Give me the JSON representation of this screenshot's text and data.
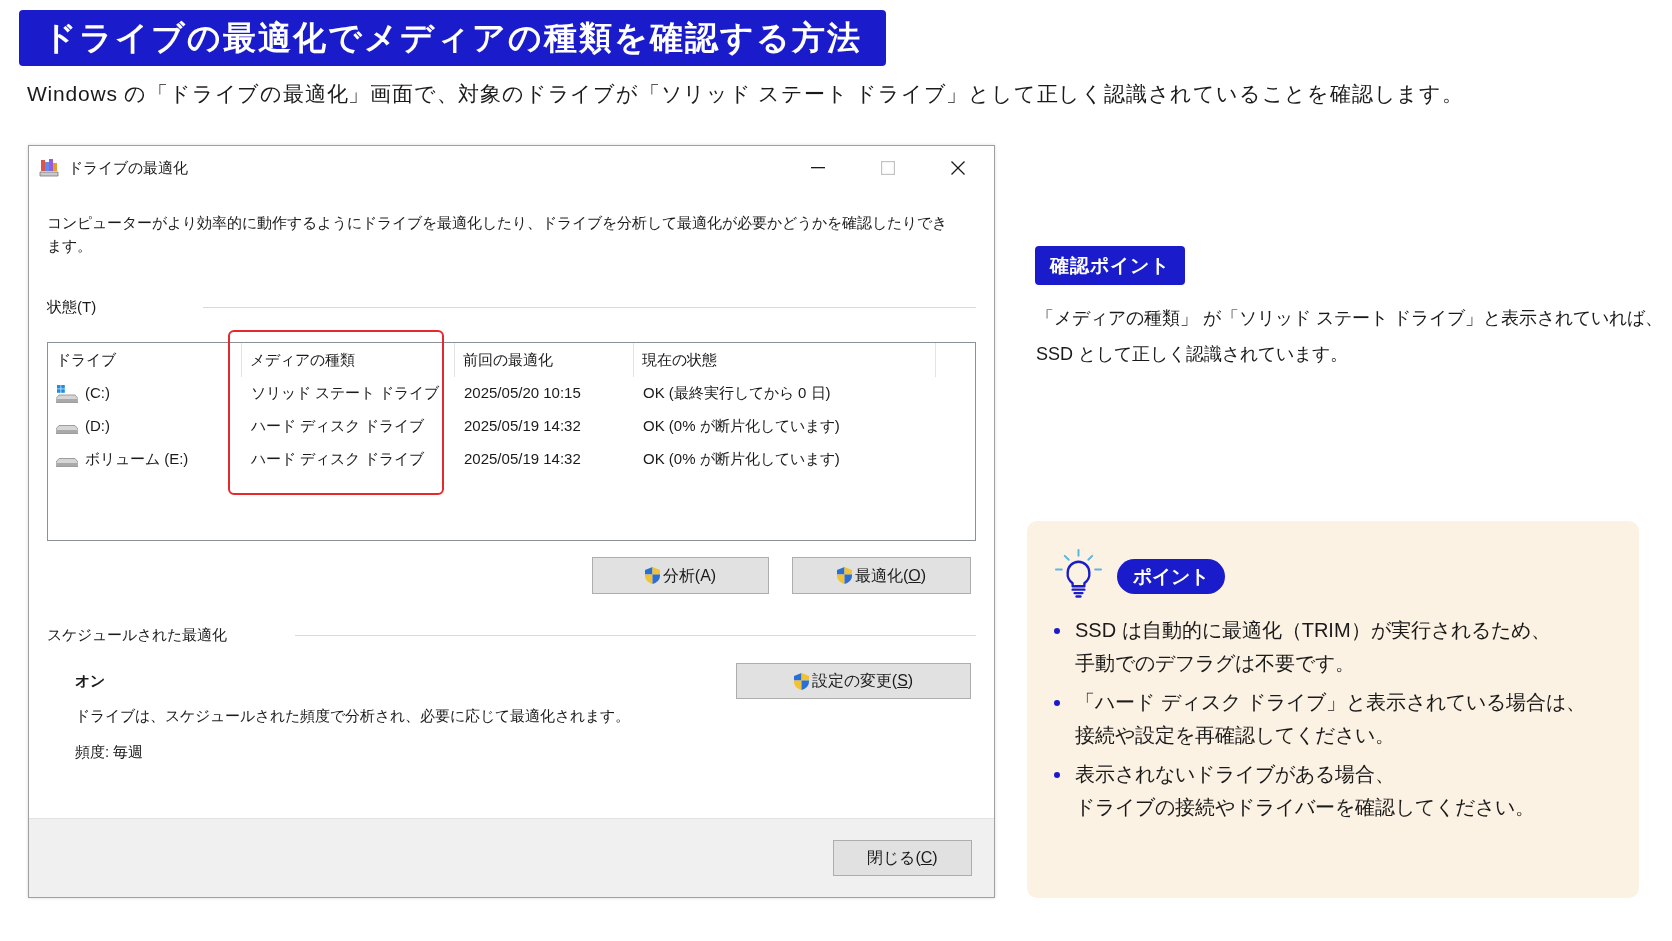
{
  "heading": "ドライブの最適化でメディアの種類を確認する方法",
  "subtitle": "Windows の「ドライブの最適化」画面で、対象のドライブが「ソリッド ステート ドライブ」として正しく認識されていることを確認します。",
  "dialog": {
    "title": "ドライブの最適化",
    "window_buttons": [
      {
        "kind": "minimize",
        "disabled": false
      },
      {
        "kind": "maximize",
        "disabled": true
      },
      {
        "kind": "close",
        "disabled": false
      }
    ],
    "description": "コンピューターがより効率的に動作するようにドライブを最適化したり、ドライブを分析して最適化が必要かどうかを確認したりできます。",
    "status_label": "状態(T)",
    "table": {
      "columns": [
        {
          "label": "ドライブ",
          "highlighted": false
        },
        {
          "label": "メディアの種類",
          "highlighted": true
        },
        {
          "label": "前回の最適化",
          "highlighted": false
        },
        {
          "label": "現在の状態",
          "highlighted": false
        }
      ],
      "rows": [
        {
          "kind": "system",
          "drive": "(C:)",
          "media_type": "ソリッド ステート ドライブ",
          "last_optimized": "2025/05/20 10:15",
          "current_status": "OK (最終実行してから 0 日)"
        },
        {
          "kind": "disk",
          "drive": "(D:)",
          "media_type": "ハード ディスク ドライブ",
          "last_optimized": "2025/05/19 14:32",
          "current_status": "OK (0% が断片化しています)"
        },
        {
          "kind": "disk",
          "drive": "ボリューム (E:)",
          "media_type": "ハード ディスク ドライブ",
          "last_optimized": "2025/05/19 14:32",
          "current_status": "OK (0% が断片化しています)"
        }
      ]
    },
    "actions": [
      {
        "label": "分析(",
        "access_key": "A",
        "label_end": ")",
        "underlined": false,
        "shield": true
      },
      {
        "label": "最適化(",
        "access_key": "O",
        "label_end": ")",
        "underlined": true,
        "shield": true
      }
    ],
    "schedule": {
      "label": "スケジュールされた最適化",
      "state": "オン",
      "description": "ドライブは、スケジュールされた頻度で分析され、必要に応じて最適化されます。",
      "frequency": "頻度: 毎週",
      "button": {
        "label": "設定の変更(",
        "access_key": "S",
        "label_end": ")",
        "underlined": true,
        "shield": true
      }
    },
    "close_button": {
      "label": "閉じる(",
      "access_key": "C",
      "label_end": ")",
      "underlined": true,
      "shield": false
    }
  },
  "check_point": {
    "badge": "確認ポイント",
    "text": "「メディアの種類」 が「ソリッド ステート ドライブ」と表示されていれば、SSD として正しく認識されています。"
  },
  "tips": {
    "badge": "ポイント",
    "items": [
      "SSD は自動的に最適化（TRIM）が実行されるため、手動でのデフラグは不要です。",
      "「ハード ディスク ドライブ」と表示されている場合は、接続や設定を再確認してください。",
      "表示されないドライブがある場合、ドライブの接続やドライバーを確認してください。"
    ]
  }
}
